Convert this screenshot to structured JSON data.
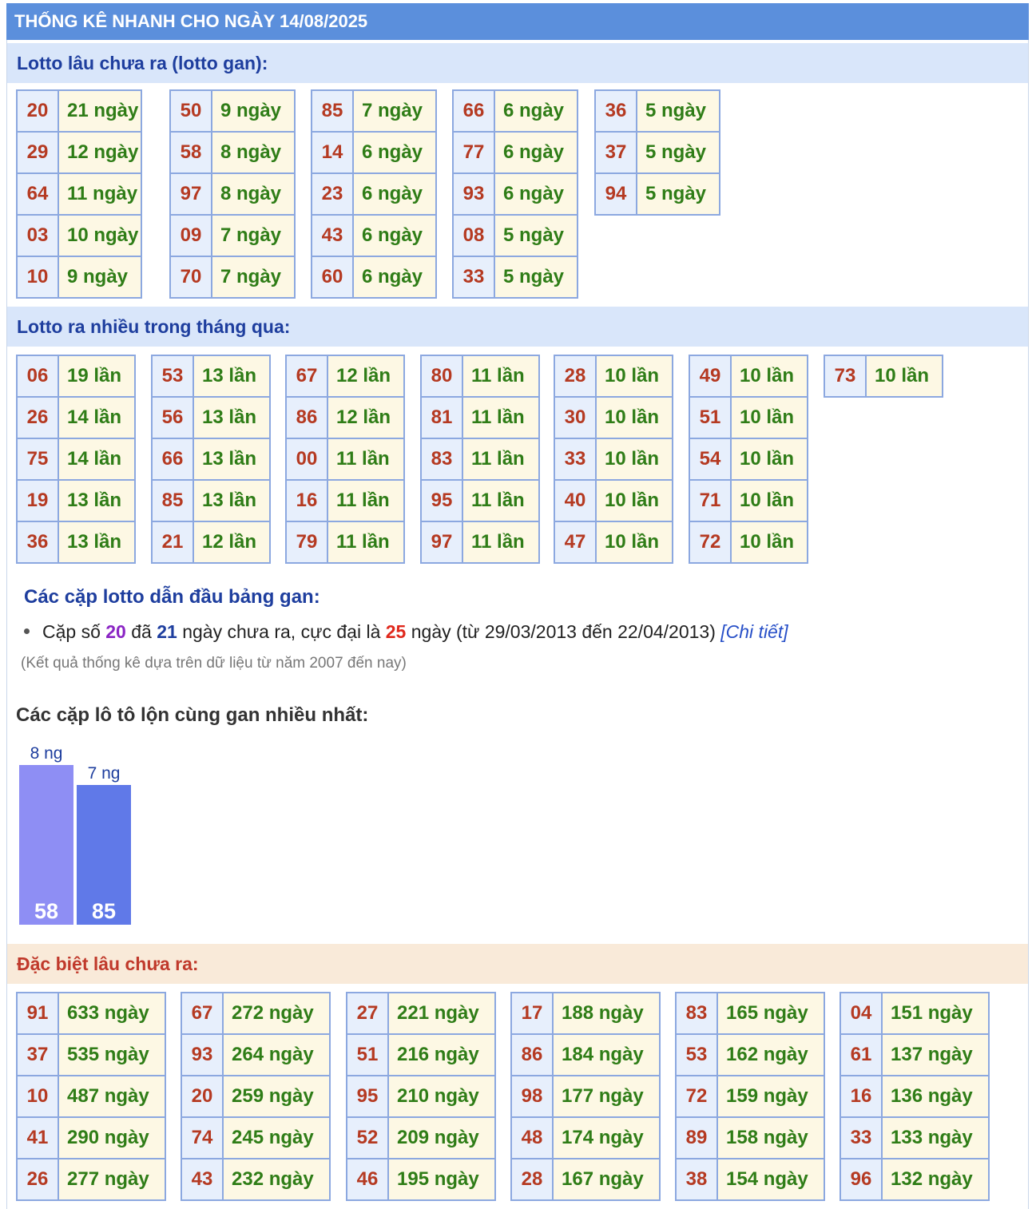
{
  "title": "THỐNG KÊ NHANH CHO NGÀY 14/08/2025",
  "gan": {
    "heading": "Lotto lâu chưa ra (lotto gan):",
    "groups": [
      [
        {
          "num": "20",
          "val": "21 ngày"
        },
        {
          "num": "29",
          "val": "12 ngày"
        },
        {
          "num": "64",
          "val": "11 ngày"
        },
        {
          "num": "03",
          "val": "10 ngày"
        },
        {
          "num": "10",
          "val": "9 ngày"
        }
      ],
      [
        {
          "num": "50",
          "val": "9 ngày"
        },
        {
          "num": "58",
          "val": "8 ngày"
        },
        {
          "num": "97",
          "val": "8 ngày"
        },
        {
          "num": "09",
          "val": "7 ngày"
        },
        {
          "num": "70",
          "val": "7 ngày"
        }
      ],
      [
        {
          "num": "85",
          "val": "7 ngày"
        },
        {
          "num": "14",
          "val": "6 ngày"
        },
        {
          "num": "23",
          "val": "6 ngày"
        },
        {
          "num": "43",
          "val": "6 ngày"
        },
        {
          "num": "60",
          "val": "6 ngày"
        }
      ],
      [
        {
          "num": "66",
          "val": "6 ngày"
        },
        {
          "num": "77",
          "val": "6 ngày"
        },
        {
          "num": "93",
          "val": "6 ngày"
        },
        {
          "num": "08",
          "val": "5 ngày"
        },
        {
          "num": "33",
          "val": "5 ngày"
        }
      ],
      [
        {
          "num": "36",
          "val": "5 ngày"
        },
        {
          "num": "37",
          "val": "5 ngày"
        },
        {
          "num": "94",
          "val": "5 ngày"
        }
      ]
    ]
  },
  "frequent": {
    "heading": "Lotto ra nhiều trong tháng qua:",
    "groups": [
      [
        {
          "num": "06",
          "val": "19 lần"
        },
        {
          "num": "26",
          "val": "14 lần"
        },
        {
          "num": "75",
          "val": "14 lần"
        },
        {
          "num": "19",
          "val": "13 lần"
        },
        {
          "num": "36",
          "val": "13 lần"
        }
      ],
      [
        {
          "num": "53",
          "val": "13 lần"
        },
        {
          "num": "56",
          "val": "13 lần"
        },
        {
          "num": "66",
          "val": "13 lần"
        },
        {
          "num": "85",
          "val": "13 lần"
        },
        {
          "num": "21",
          "val": "12 lần"
        }
      ],
      [
        {
          "num": "67",
          "val": "12 lần"
        },
        {
          "num": "86",
          "val": "12 lần"
        },
        {
          "num": "00",
          "val": "11 lần"
        },
        {
          "num": "16",
          "val": "11 lần"
        },
        {
          "num": "79",
          "val": "11 lần"
        }
      ],
      [
        {
          "num": "80",
          "val": "11 lần"
        },
        {
          "num": "81",
          "val": "11 lần"
        },
        {
          "num": "83",
          "val": "11 lần"
        },
        {
          "num": "95",
          "val": "11 lần"
        },
        {
          "num": "97",
          "val": "11 lần"
        }
      ],
      [
        {
          "num": "28",
          "val": "10 lần"
        },
        {
          "num": "30",
          "val": "10 lần"
        },
        {
          "num": "33",
          "val": "10 lần"
        },
        {
          "num": "40",
          "val": "10 lần"
        },
        {
          "num": "47",
          "val": "10 lần"
        }
      ],
      [
        {
          "num": "49",
          "val": "10 lần"
        },
        {
          "num": "51",
          "val": "10 lần"
        },
        {
          "num": "54",
          "val": "10 lần"
        },
        {
          "num": "71",
          "val": "10 lần"
        },
        {
          "num": "72",
          "val": "10 lần"
        }
      ],
      [
        {
          "num": "73",
          "val": "10 lần"
        }
      ]
    ]
  },
  "lead": {
    "heading": "Các cặp lotto dẫn đầu bảng gan:",
    "prefix": "Cặp số",
    "pair": "20",
    "mid1": "đã",
    "days": "21",
    "mid2": "ngày chưa ra, cực đại là",
    "max": "25",
    "suffix": "ngày (từ 29/03/2013 đến 22/04/2013)",
    "link": "[Chi tiết]",
    "note": "(Kết quả thống kê dựa trên dữ liệu từ năm 2007 đến nay)"
  },
  "pairs": {
    "heading": "Các cặp lô tô lộn cùng gan nhiều nhất:"
  },
  "chart_data": {
    "type": "bar",
    "categories": [
      "58",
      "85"
    ],
    "values": [
      8,
      7
    ],
    "value_labels": [
      "8 ng",
      "7 ng"
    ],
    "colors": [
      "#8e8ef4",
      "#6079e8"
    ],
    "title": "",
    "xlabel": "",
    "ylabel": "",
    "ylim": [
      0,
      8
    ]
  },
  "special": {
    "heading": "Đặc biệt lâu chưa ra:",
    "groups": [
      [
        {
          "num": "91",
          "val": "633 ngày"
        },
        {
          "num": "37",
          "val": "535 ngày"
        },
        {
          "num": "10",
          "val": "487 ngày"
        },
        {
          "num": "41",
          "val": "290 ngày"
        },
        {
          "num": "26",
          "val": "277 ngày"
        }
      ],
      [
        {
          "num": "67",
          "val": "272 ngày"
        },
        {
          "num": "93",
          "val": "264 ngày"
        },
        {
          "num": "20",
          "val": "259 ngày"
        },
        {
          "num": "74",
          "val": "245 ngày"
        },
        {
          "num": "43",
          "val": "232 ngày"
        }
      ],
      [
        {
          "num": "27",
          "val": "221 ngày"
        },
        {
          "num": "51",
          "val": "216 ngày"
        },
        {
          "num": "95",
          "val": "210 ngày"
        },
        {
          "num": "52",
          "val": "209 ngày"
        },
        {
          "num": "46",
          "val": "195 ngày"
        }
      ],
      [
        {
          "num": "17",
          "val": "188 ngày"
        },
        {
          "num": "86",
          "val": "184 ngày"
        },
        {
          "num": "98",
          "val": "177 ngày"
        },
        {
          "num": "48",
          "val": "174 ngày"
        },
        {
          "num": "28",
          "val": "167 ngày"
        }
      ],
      [
        {
          "num": "83",
          "val": "165 ngày"
        },
        {
          "num": "53",
          "val": "162 ngày"
        },
        {
          "num": "72",
          "val": "159 ngày"
        },
        {
          "num": "89",
          "val": "158 ngày"
        },
        {
          "num": "38",
          "val": "154 ngày"
        }
      ],
      [
        {
          "num": "04",
          "val": "151 ngày"
        },
        {
          "num": "61",
          "val": "137 ngày"
        },
        {
          "num": "16",
          "val": "136 ngày"
        },
        {
          "num": "33",
          "val": "133 ngày"
        },
        {
          "num": "96",
          "val": "132 ngày"
        }
      ]
    ]
  }
}
